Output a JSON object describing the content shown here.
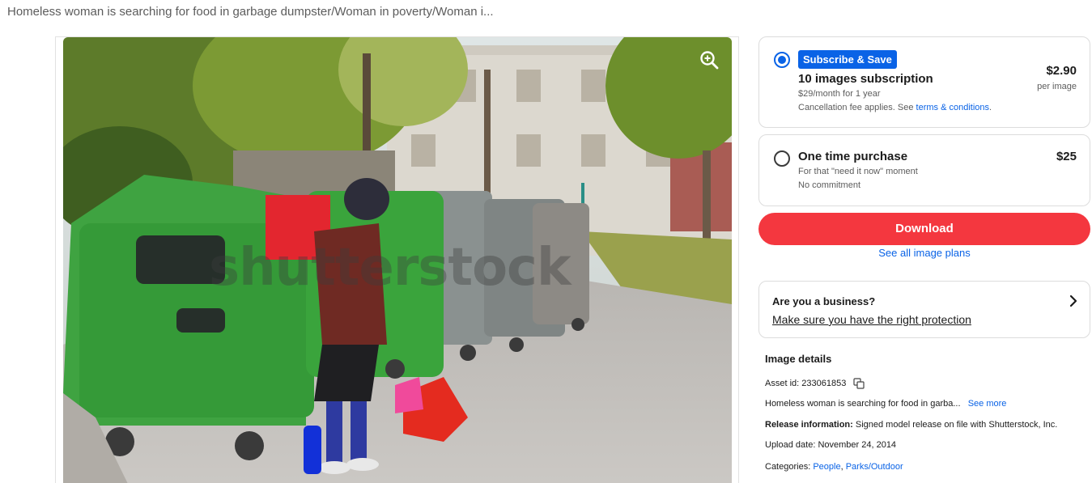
{
  "page": {
    "title": "Homeless woman is searching for food in garbage dumpster/Woman in poverty/Woman i..."
  },
  "image": {
    "watermark": "shutterstock",
    "zoom_icon": "zoom-in-icon"
  },
  "subscription": {
    "badge": "Subscribe & Save",
    "plan": "10 images subscription",
    "term": "$29/month for 1 year",
    "fee_prefix": "Cancellation fee applies. See ",
    "fee_link": "terms & conditions",
    "fee_suffix": ".",
    "price": "$2.90",
    "per": "per image",
    "selected": true
  },
  "one_time": {
    "plan": "One time purchase",
    "desc": "For that \"need it now\" moment",
    "note": "No commitment",
    "price": "$25",
    "selected": false
  },
  "actions": {
    "download": "Download",
    "see_plans": "See all image plans"
  },
  "business": {
    "question": "Are you a business?",
    "link": "Make sure you have the right protection",
    "icon": "chevron-right-icon"
  },
  "details": {
    "heading": "Image details",
    "asset_label": "Asset id: ",
    "asset_id": "233061853",
    "description": "Homeless woman is searching for food in garba...",
    "see_more": "See more",
    "release_label": "Release information:",
    "release_value": " Signed model release on file with Shutterstock, Inc.",
    "upload_label": "Upload date: ",
    "upload_value": "November 24, 2014",
    "categories_label": "Categories: ",
    "categories": [
      "People",
      "Parks/Outdoor"
    ],
    "category_sep": ", "
  },
  "colors": {
    "accent_blue": "#0a63e6",
    "download_red": "#f4373f"
  }
}
